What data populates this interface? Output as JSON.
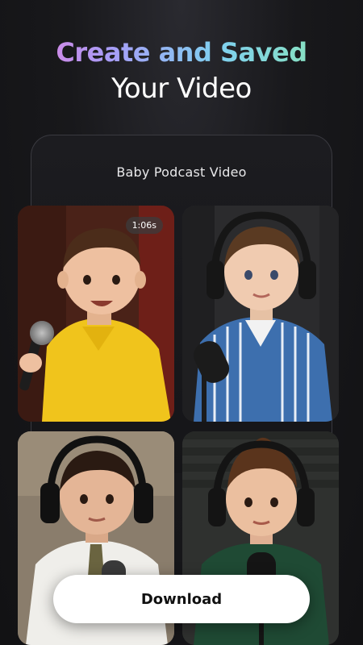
{
  "header": {
    "title_line1": "Create and Saved",
    "title_line2": "Your Video"
  },
  "card": {
    "title": "Baby Podcast Video"
  },
  "videos": [
    {
      "duration": "1:06s",
      "thumbnail": "baby-yellow-shirt-microphone"
    },
    {
      "thumbnail": "baby-striped-shirt-headphones"
    },
    {
      "thumbnail": "baby-white-shirt-tie-headphones"
    },
    {
      "thumbnail": "baby-green-sweater-headphones"
    }
  ],
  "actions": {
    "download_label": "Download"
  },
  "colors": {
    "background": "#141416",
    "button": "#ffffff",
    "gradient_start": "#f07ad8",
    "gradient_end": "#8be9a8"
  }
}
